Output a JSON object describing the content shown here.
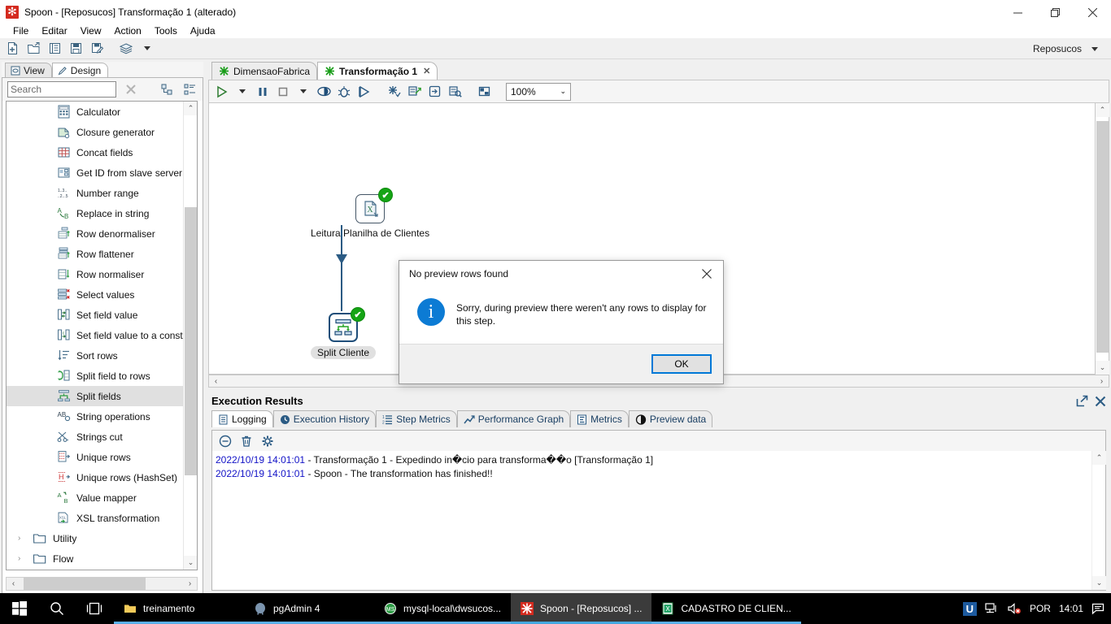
{
  "window": {
    "title": "Spoon - [Reposucos] Transformação 1 (alterado)",
    "minimize": "—",
    "maximize": "❐",
    "close": "✕"
  },
  "menu": {
    "items": [
      "File",
      "Editar",
      "View",
      "Action",
      "Tools",
      "Ajuda"
    ]
  },
  "toolbar": {
    "buttons": [
      "new-icon",
      "open-icon",
      "explore-icon",
      "save-icon",
      "save-as-icon",
      "layers-icon",
      "dropdown-arrow-icon"
    ],
    "repository_label": "Reposucos"
  },
  "left_panel": {
    "tabs": [
      {
        "label": "View",
        "icon": "view-icon",
        "active": false
      },
      {
        "label": "Design",
        "icon": "pencil-icon",
        "active": true
      }
    ],
    "search": {
      "placeholder": "Search",
      "value": ""
    },
    "search_buttons": [
      "clear-icon",
      "collapse-all-icon",
      "expand-all-icon"
    ],
    "tree_items": [
      {
        "label": "Calculator",
        "icon": "calculator-icon"
      },
      {
        "label": "Closure generator",
        "icon": "closure-icon"
      },
      {
        "label": "Concat fields",
        "icon": "concat-icon"
      },
      {
        "label": "Get ID from slave server",
        "icon": "slave-id-icon"
      },
      {
        "label": "Number range",
        "icon": "number-range-icon"
      },
      {
        "label": "Replace in string",
        "icon": "replace-string-icon"
      },
      {
        "label": "Row denormaliser",
        "icon": "row-denormaliser-icon"
      },
      {
        "label": "Row flattener",
        "icon": "row-flattener-icon"
      },
      {
        "label": "Row normaliser",
        "icon": "row-normaliser-icon"
      },
      {
        "label": "Select values",
        "icon": "select-values-icon"
      },
      {
        "label": "Set field value",
        "icon": "set-field-value-icon"
      },
      {
        "label": "Set field value to a consta",
        "icon": "set-field-const-icon"
      },
      {
        "label": "Sort rows",
        "icon": "sort-rows-icon"
      },
      {
        "label": "Split field to rows",
        "icon": "split-field-rows-icon"
      },
      {
        "label": "Split fields",
        "icon": "split-fields-icon",
        "selected": true
      },
      {
        "label": "String operations",
        "icon": "string-operations-icon"
      },
      {
        "label": "Strings cut",
        "icon": "strings-cut-icon"
      },
      {
        "label": "Unique rows",
        "icon": "unique-rows-icon"
      },
      {
        "label": "Unique rows (HashSet)",
        "icon": "unique-rows-hashset-icon"
      },
      {
        "label": "Value mapper",
        "icon": "value-mapper-icon"
      },
      {
        "label": "XSL transformation",
        "icon": "xsl-transformation-icon"
      }
    ],
    "folders": [
      {
        "label": "Utility",
        "icon": "folder-icon",
        "expander": "›"
      },
      {
        "label": "Flow",
        "icon": "folder-icon",
        "expander": "›"
      }
    ]
  },
  "canvas": {
    "tabs": [
      {
        "label": "DimensaoFabrica",
        "icon": "transformation-icon",
        "active": false,
        "closable": false
      },
      {
        "label": "Transformação 1",
        "icon": "transformation-icon",
        "active": true,
        "closable": true,
        "close_glyph": "✕"
      }
    ],
    "toolbar_buttons": [
      "run-icon",
      "run-options-icon",
      "pause-icon",
      "stop-icon",
      "stop-options-icon",
      "preview-icon",
      "debug-icon",
      "replay-icon",
      "verify-icon",
      "impact-icon",
      "sql-icon",
      "explore-icon",
      "show-grid-icon"
    ],
    "zoom": "100%",
    "steps": [
      {
        "name": "Leitura Planilha de Clientes",
        "icon": "excel-input-icon",
        "status": "ok",
        "selected": false
      },
      {
        "name": "Split Cliente",
        "icon": "split-fields-icon",
        "status": "ok",
        "selected": true
      }
    ]
  },
  "dialog": {
    "title": "No preview rows found",
    "message": "Sorry, during preview there weren't any rows to display for this step.",
    "icon": "info-icon",
    "ok_label": "OK",
    "close_glyph": "✕"
  },
  "execution_results": {
    "title": "Execution Results",
    "header_buttons": [
      "maximize-icon",
      "close-icon"
    ],
    "tabs": [
      {
        "label": "Logging",
        "icon": "log-icon",
        "active": true
      },
      {
        "label": "Execution History",
        "icon": "history-icon",
        "active": false
      },
      {
        "label": "Step Metrics",
        "icon": "step-metrics-icon",
        "active": false
      },
      {
        "label": "Performance Graph",
        "icon": "performance-graph-icon",
        "active": false
      },
      {
        "label": "Metrics",
        "icon": "metrics-icon",
        "active": false
      },
      {
        "label": "Preview data",
        "icon": "preview-data-icon",
        "active": false
      }
    ],
    "log_toolbar": [
      "collapse-icon",
      "clear-log-icon",
      "log-settings-icon"
    ],
    "log_lines": [
      {
        "timestamp": "2022/10/19 14:01:01",
        "text": " - Transformação 1 - Expedindo in�cio para transforma��o [Transformação 1]"
      },
      {
        "timestamp": "2022/10/19 14:01:01",
        "text": " - Spoon - The transformation has finished!!"
      }
    ]
  },
  "taskbar": {
    "start_icon": "windows-start-icon",
    "search_icon": "search-icon",
    "taskview_icon": "task-view-icon",
    "apps": [
      {
        "label": "treinamento",
        "icon": "folder-icon",
        "active": false
      },
      {
        "label": "pgAdmin 4",
        "icon": "pgadmin-icon",
        "active": false
      },
      {
        "label": "mysql-local\\dwsucos...",
        "icon": "mysql-icon",
        "active": false
      },
      {
        "label": "Spoon - [Reposucos] ...",
        "icon": "spoon-icon",
        "active": true
      },
      {
        "label": "CADASTRO DE CLIEN...",
        "icon": "excel-icon",
        "active": false
      }
    ],
    "tray": {
      "u_badge": "U",
      "network_icon": "network-icon",
      "volume_icon": "volume-muted-icon",
      "language": "POR",
      "clock": "14:01",
      "notification_icon": "notification-icon"
    }
  },
  "colors": {
    "accent_blue": "#0078d7",
    "step_border": "#1f4e79",
    "ok_green": "#15a415",
    "log_timestamp": "#1212c7",
    "spoon_red": "#d42b1f"
  }
}
